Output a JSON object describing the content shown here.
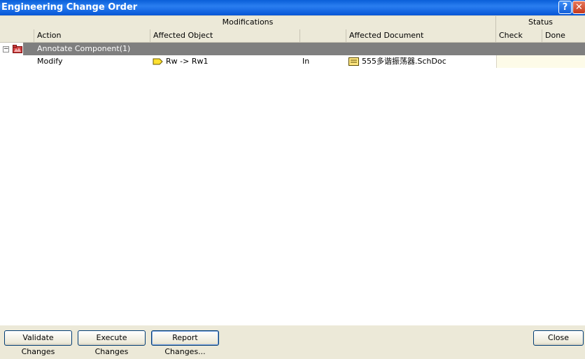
{
  "window": {
    "title": "Engineering Change Order"
  },
  "header": {
    "groups": {
      "modifications": "Modifications",
      "status": "Status"
    },
    "columns": {
      "action": "Action",
      "affected_object": "Affected Object",
      "affected_document": "Affected Document",
      "check": "Check",
      "done": "Done"
    }
  },
  "rows": {
    "group": {
      "label": "Annotate Component(1)"
    },
    "item": {
      "action": "Modify",
      "object": "Rw -> Rw1",
      "relation": "In",
      "document": "555多谐振荡器.SchDoc"
    }
  },
  "buttons": {
    "validate": "Validate Changes",
    "execute": "Execute Changes",
    "report": "Report Changes...",
    "close": "Close"
  }
}
